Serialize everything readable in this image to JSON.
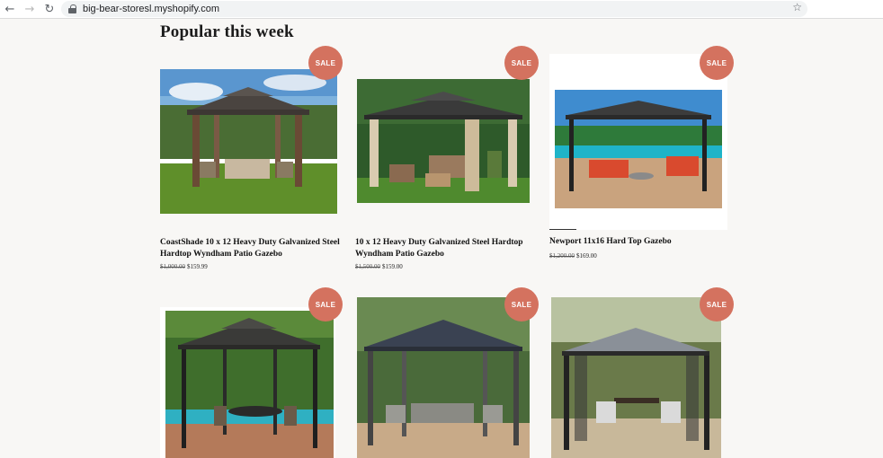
{
  "browser": {
    "back_icon": "←",
    "forward_icon": "→",
    "reload_icon": "↻",
    "url": "big-bear-storesl.myshopify.com",
    "star_icon": "☆"
  },
  "section": {
    "title": "Popular this week"
  },
  "sale_label": "SALE",
  "products": [
    {
      "title": "CoastShade 10 x 12 Heavy Duty Galvanized Steel Hardtop Wyndham Patio Gazebo",
      "old_price": "$1,000.00",
      "price": "$159.99"
    },
    {
      "title": "10 x 12 Heavy Duty Galvanized Steel Hardtop Wyndham Patio Gazebo",
      "old_price": "$1,500.00",
      "price": "$159.00"
    },
    {
      "title": "Newport 11x16 Hard Top Gazebo",
      "old_price": "$1,200.00",
      "price": "$169.00"
    }
  ],
  "colors": {
    "sale_badge": "#d4725f",
    "background": "#f8f7f5"
  }
}
